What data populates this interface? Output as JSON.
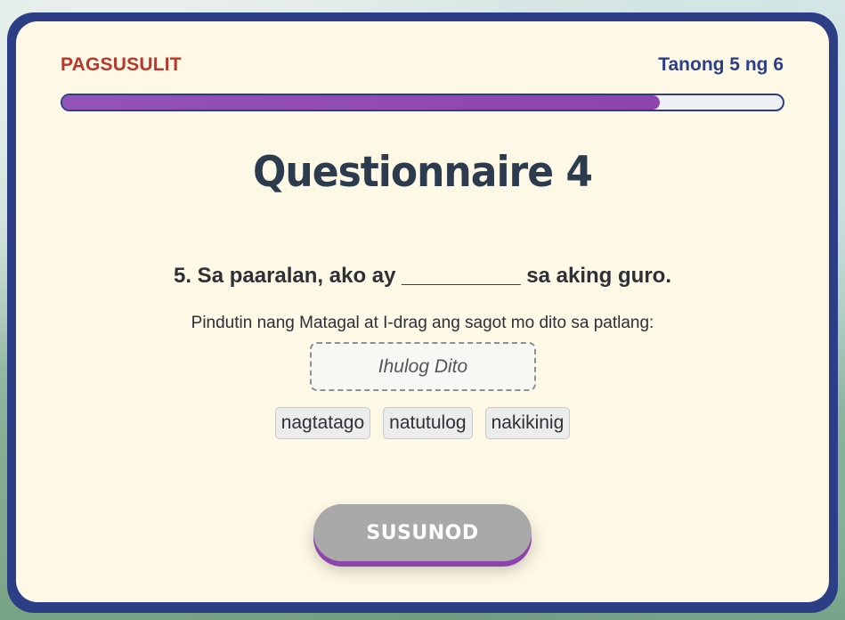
{
  "header": {
    "label": "PAGSUSULIT",
    "counter": "Tanong 5 ng 6"
  },
  "progress": {
    "fraction": 0.83
  },
  "quiz": {
    "title": "Questionnaire 4",
    "question": "5. Sa paaralan, ako ay __________ sa aking guro.",
    "instruction": "Pindutin nang Matagal at I-drag ang sagot mo dito sa patlang:",
    "dropzone_placeholder": "Ihulog Dito",
    "choices": [
      "nagtatago",
      "natutulog",
      "nakikinig"
    ]
  },
  "actions": {
    "next_label": "SUSUNOD"
  },
  "colors": {
    "frame": "#2c3e86",
    "card": "#fef8e6",
    "header_label": "#b8392b",
    "progress_fill": "#8e44ad",
    "button_disabled": "#a9a9a9"
  }
}
